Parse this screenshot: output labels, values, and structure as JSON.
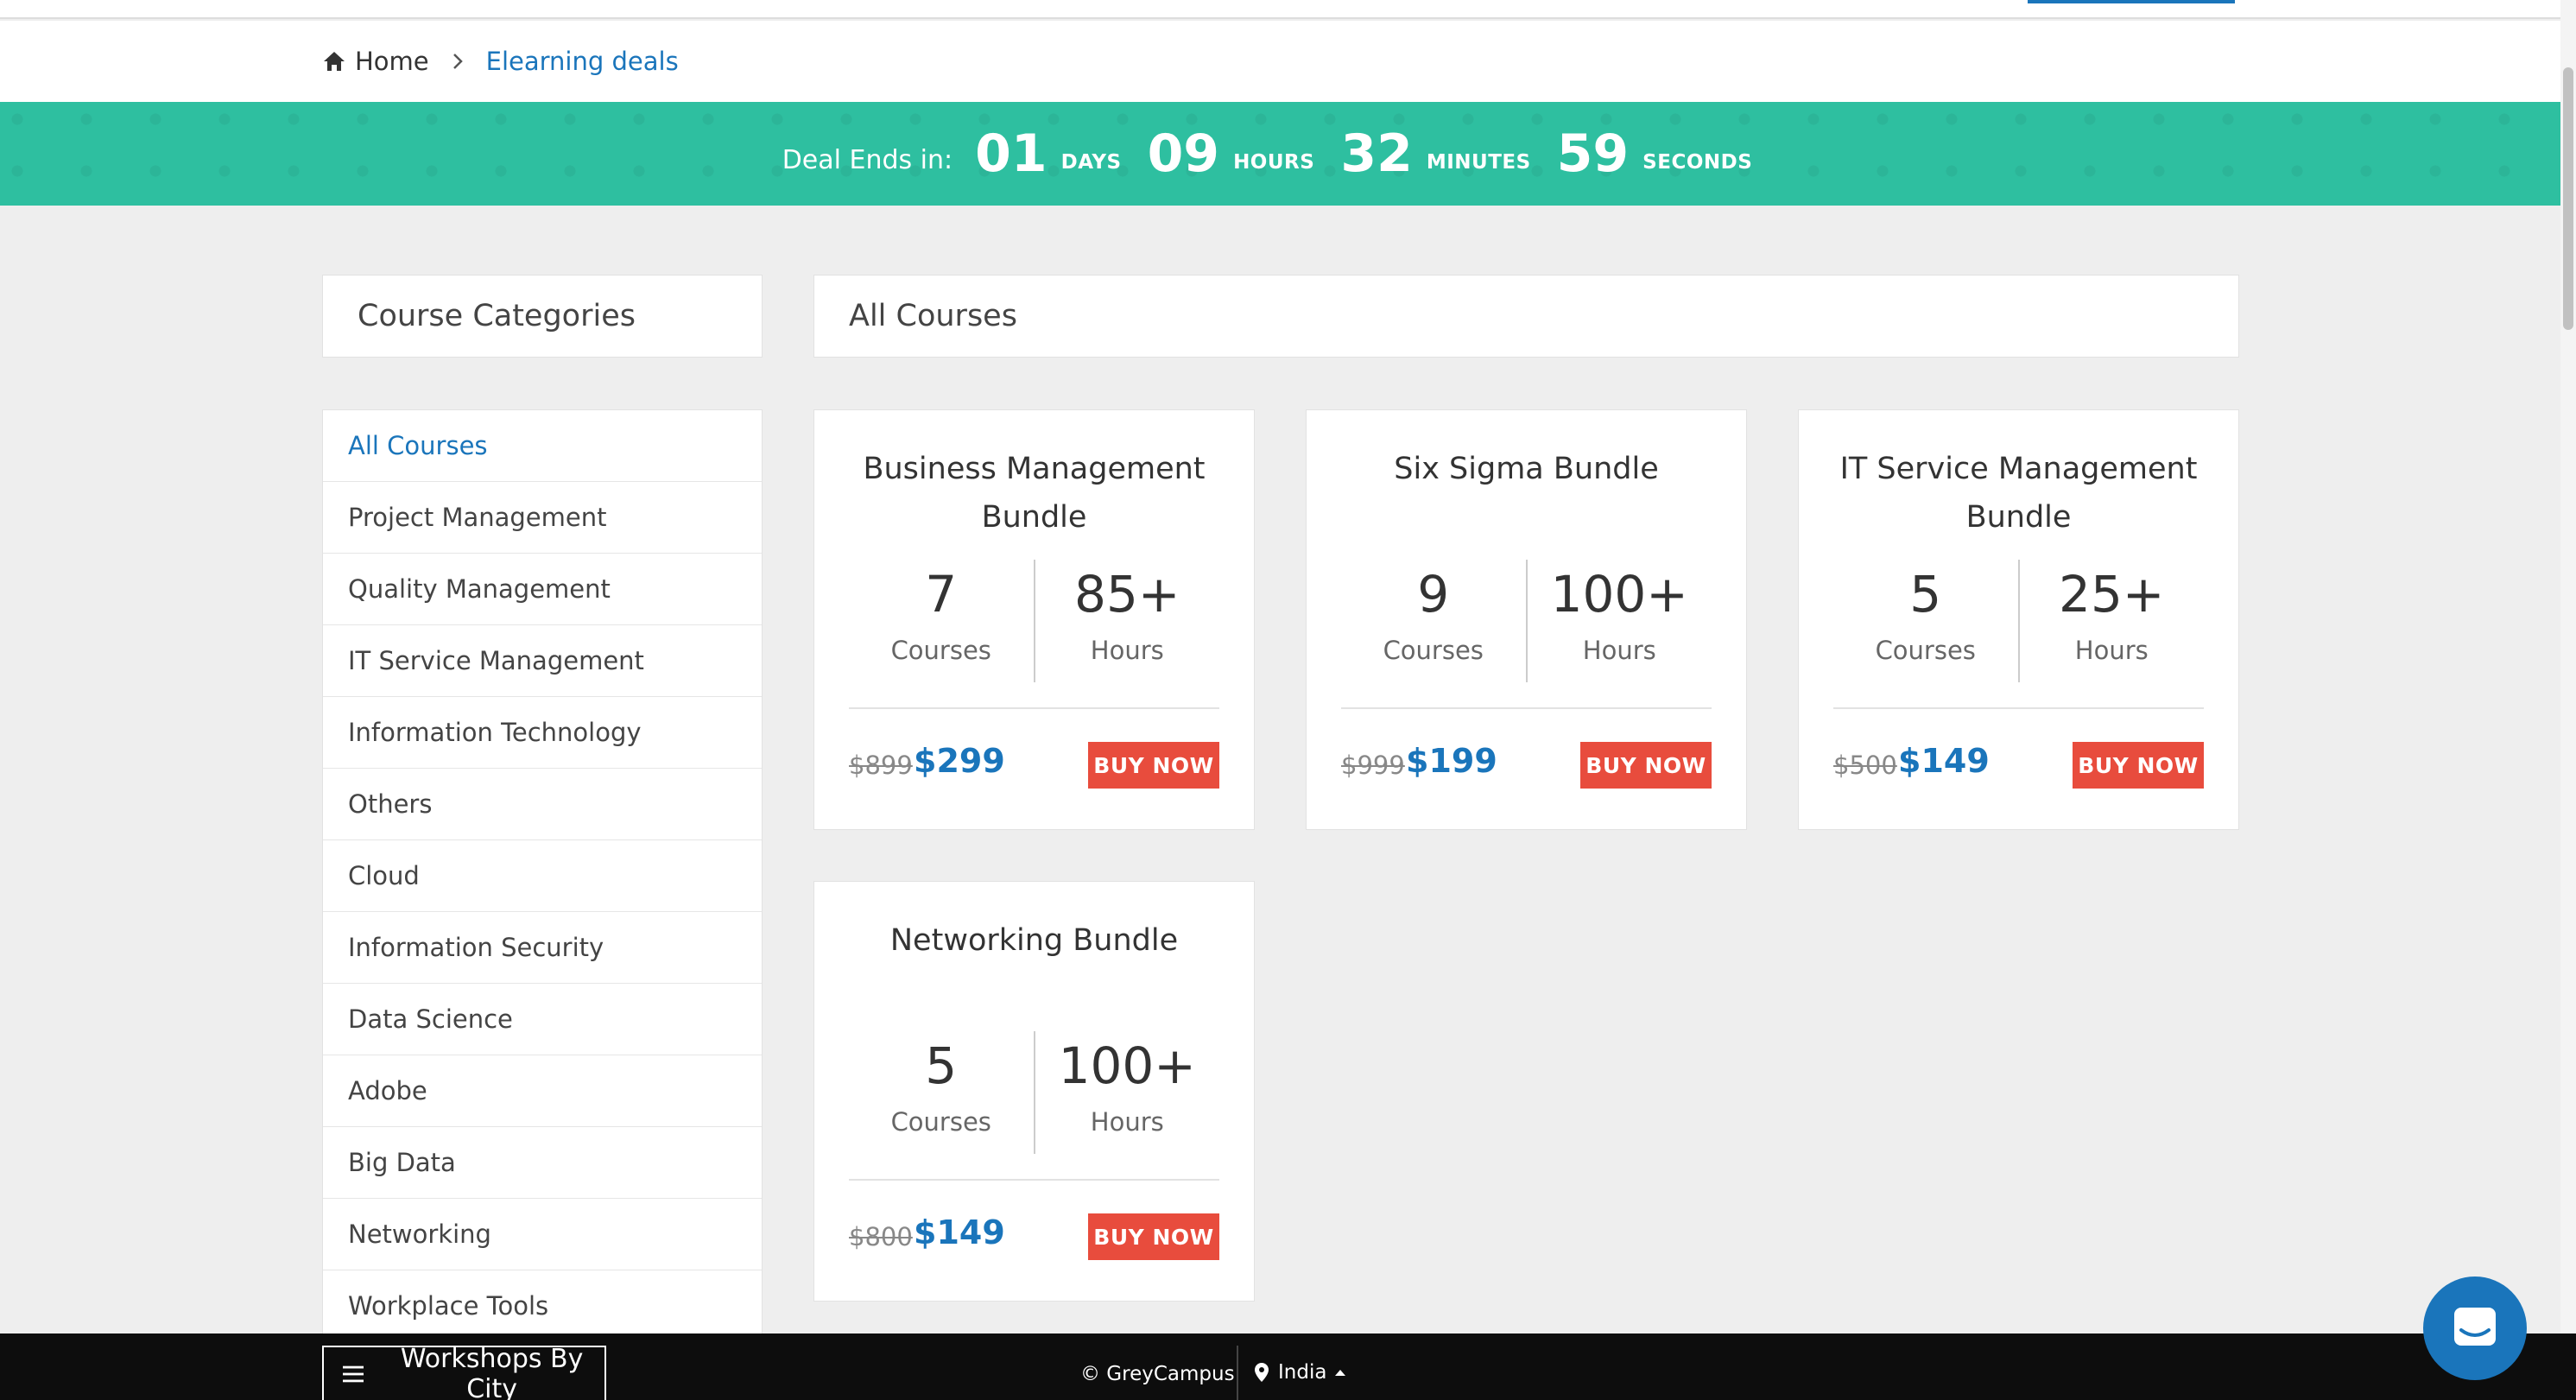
{
  "breadcrumb": {
    "home": "Home",
    "current": "Elearning deals"
  },
  "deal": {
    "label": "Deal Ends in:",
    "days": "01",
    "days_unit": "DAYS",
    "hours": "09",
    "hours_unit": "HOURS",
    "minutes": "32",
    "minutes_unit": "MINUTES",
    "seconds": "59",
    "seconds_unit": "SECONDS"
  },
  "sidebar": {
    "title": "Course Categories",
    "items": [
      "All Courses",
      "Project Management",
      "Quality Management",
      "IT Service Management",
      "Information Technology",
      "Others",
      "Cloud",
      "Information Security",
      "Data Science",
      "Adobe",
      "Big Data",
      "Networking",
      "Workplace Tools"
    ]
  },
  "main": {
    "title": "All Courses",
    "courses": [
      {
        "title": "Business Management Bundle",
        "courses": "7",
        "courses_label": "Courses",
        "hours": "85+",
        "hours_label": "Hours",
        "old_price": "$899",
        "price": "$299",
        "buy": "BUY NOW"
      },
      {
        "title": "Six Sigma Bundle",
        "courses": "9",
        "courses_label": "Courses",
        "hours": "100+",
        "hours_label": "Hours",
        "old_price": "$999",
        "price": "$199",
        "buy": "BUY NOW"
      },
      {
        "title": "IT Service Management Bundle",
        "courses": "5",
        "courses_label": "Courses",
        "hours": "25+",
        "hours_label": "Hours",
        "old_price": "$500",
        "price": "$149",
        "buy": "BUY NOW"
      },
      {
        "title": "Networking Bundle",
        "courses": "5",
        "courses_label": "Courses",
        "hours": "100+",
        "hours_label": "Hours",
        "old_price": "$800",
        "price": "$149",
        "buy": "BUY NOW"
      }
    ]
  },
  "footer": {
    "workshops": "Workshops By City",
    "copyright": "© GreyCampus",
    "location": "India"
  },
  "colors": {
    "accent": "#1a75bb",
    "banner": "#2ebfa0",
    "buy_button": "#e84c3d",
    "footer": "#0d0d0d"
  },
  "icons": [
    "home-icon",
    "chevron-right-icon",
    "menu-icon",
    "map-pin-icon",
    "caret-up-icon",
    "chat-icon"
  ]
}
